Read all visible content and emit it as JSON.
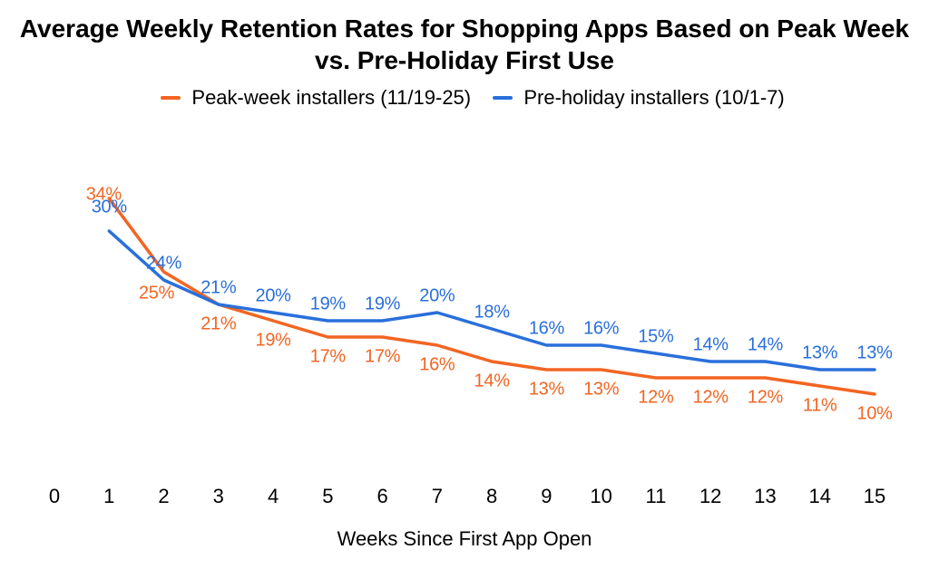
{
  "chart_data": {
    "type": "line",
    "title": "Average Weekly Retention Rates for Shopping Apps Based on Peak Week vs. Pre-Holiday First Use",
    "xlabel": "Weeks Since First App Open",
    "ylabel": "",
    "x": [
      0,
      1,
      2,
      3,
      4,
      5,
      6,
      7,
      8,
      9,
      10,
      11,
      12,
      13,
      14,
      15
    ],
    "ylim": [
      0,
      40
    ],
    "series": [
      {
        "name": "Peak-week installers (11/19-25)",
        "color": "#f26522",
        "values": [
          null,
          34,
          25,
          21,
          19,
          17,
          17,
          16,
          14,
          13,
          13,
          12,
          12,
          12,
          11,
          10
        ]
      },
      {
        "name": "Pre-holiday installers (10/1-7)",
        "color": "#2a6fdb",
        "values": [
          null,
          30,
          24,
          21,
          20,
          19,
          19,
          20,
          18,
          16,
          16,
          15,
          14,
          14,
          13,
          13
        ]
      }
    ],
    "x_ticks": [
      0,
      1,
      2,
      3,
      4,
      5,
      6,
      7,
      8,
      9,
      10,
      11,
      12,
      13,
      14,
      15
    ]
  }
}
